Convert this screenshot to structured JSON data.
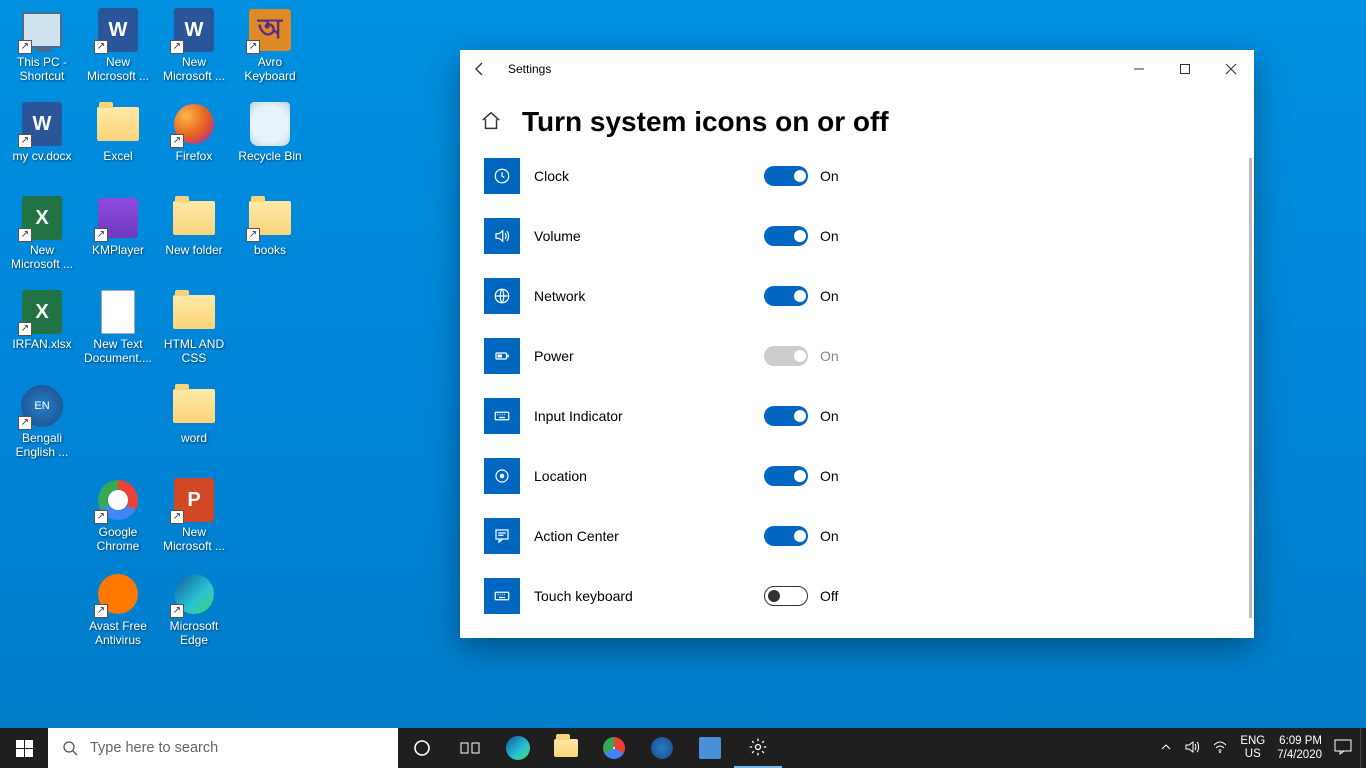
{
  "desktop": {
    "rows": [
      [
        {
          "name": "this-pc",
          "label": "This PC - Shortcut",
          "type": "pc",
          "shortcut": true
        },
        {
          "name": "word-new1",
          "label": "New Microsoft ...",
          "type": "word",
          "shortcut": true
        },
        {
          "name": "word-new2",
          "label": "New Microsoft ...",
          "type": "word",
          "shortcut": true
        },
        {
          "name": "avro",
          "label": "Avro Keyboard",
          "type": "avro",
          "shortcut": true
        }
      ],
      [
        {
          "name": "mycv",
          "label": "my cv.docx",
          "type": "word",
          "shortcut": true
        },
        {
          "name": "excel-folder",
          "label": "Excel",
          "type": "folder"
        },
        {
          "name": "firefox",
          "label": "Firefox",
          "type": "firefox",
          "shortcut": true
        },
        {
          "name": "recycle",
          "label": "Recycle Bin",
          "type": "recycle"
        }
      ],
      [
        {
          "name": "excel-new",
          "label": "New Microsoft ...",
          "type": "excel",
          "shortcut": true
        },
        {
          "name": "kmplayer",
          "label": "KMPlayer",
          "type": "km",
          "shortcut": true
        },
        {
          "name": "new-folder",
          "label": "New folder",
          "type": "folder"
        },
        {
          "name": "books",
          "label": "books",
          "type": "folder",
          "shortcut": true
        }
      ],
      [
        {
          "name": "irfan",
          "label": "IRFAN.xlsx",
          "type": "excel",
          "shortcut": true
        },
        {
          "name": "new-text",
          "label": "New Text Document....",
          "type": "doc"
        },
        {
          "name": "html-css",
          "label": "HTML AND CSS",
          "type": "folder"
        }
      ],
      [
        {
          "name": "beng-eng",
          "label": "Bengali English ...",
          "type": "globe",
          "shortcut": true
        },
        null,
        {
          "name": "word-folder",
          "label": "word",
          "type": "folder"
        }
      ],
      [
        null,
        {
          "name": "chrome",
          "label": "Google Chrome",
          "type": "chrome",
          "shortcut": true
        },
        {
          "name": "ppt-new",
          "label": "New Microsoft ...",
          "type": "ppt",
          "shortcut": true
        }
      ],
      [
        null,
        {
          "name": "avast",
          "label": "Avast Free Antivirus",
          "type": "avast",
          "shortcut": true
        },
        {
          "name": "edge",
          "label": "Microsoft Edge",
          "type": "edge",
          "shortcut": true
        }
      ]
    ]
  },
  "settings": {
    "windowTitle": "Settings",
    "pageTitle": "Turn system icons on or off",
    "items": [
      {
        "key": "clock",
        "label": "Clock",
        "state": "On",
        "mode": "on",
        "icon": "clock"
      },
      {
        "key": "volume",
        "label": "Volume",
        "state": "On",
        "mode": "on",
        "icon": "volume"
      },
      {
        "key": "network",
        "label": "Network",
        "state": "On",
        "mode": "on",
        "icon": "network"
      },
      {
        "key": "power",
        "label": "Power",
        "state": "On",
        "mode": "disabled",
        "icon": "power"
      },
      {
        "key": "input",
        "label": "Input Indicator",
        "state": "On",
        "mode": "on",
        "icon": "keyboard"
      },
      {
        "key": "location",
        "label": "Location",
        "state": "On",
        "mode": "on",
        "icon": "location"
      },
      {
        "key": "action",
        "label": "Action Center",
        "state": "On",
        "mode": "on",
        "icon": "action"
      },
      {
        "key": "touch",
        "label": "Touch keyboard",
        "state": "Off",
        "mode": "off",
        "icon": "keyboard"
      }
    ]
  },
  "taskbar": {
    "searchPlaceholder": "Type here to search",
    "lang1": "ENG",
    "lang2": "US",
    "time": "6:09 PM",
    "date": "7/4/2020"
  }
}
